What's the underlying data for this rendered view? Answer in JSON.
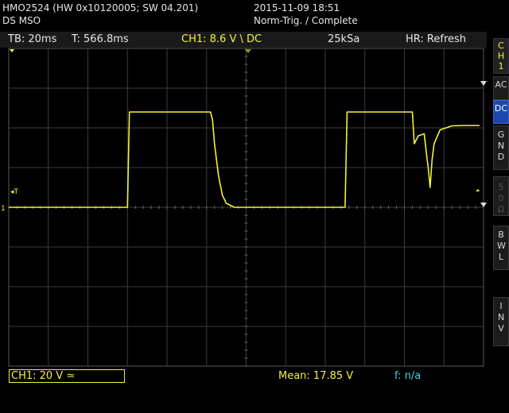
{
  "header": {
    "model": "HMO2524 (HW 0x10120005; SW 04.201)",
    "type": "DS MSO",
    "datetime": "2015-11-09 18:51",
    "trigger_status": "Norm-Trig. / Complete"
  },
  "infobar": {
    "timebase": "TB: 20ms",
    "trigger_time": "T: 566.8ms",
    "channel_trigger": "CH1: 8.6 V \\ DC",
    "sample_rate": "25kSa",
    "acquisition": "HR: Refresh"
  },
  "sidebar": {
    "channel_tab": [
      "C",
      "H",
      "1"
    ],
    "buttons": [
      {
        "label": "AC",
        "active": false
      },
      {
        "label": "DC",
        "active": true
      },
      {
        "label": "GND",
        "active": false
      },
      {
        "label": "50Ω",
        "active": false
      },
      {
        "label": "BWL",
        "active": false
      },
      {
        "label": "INV",
        "active": false
      }
    ]
  },
  "footer": {
    "channel_scale": "CH1: 20 V ≃",
    "mean": "Mean: 17.85 V",
    "frequency": "f: n/a"
  },
  "markers": {
    "trigger_label": "T",
    "channel_marker": "1"
  },
  "colors": {
    "trace": "#f2f23a",
    "grid": "#3c3c3c",
    "active_button": "#1c48b0",
    "frequency_text": "#3ad6e6"
  },
  "chart_data": {
    "type": "line",
    "title": "",
    "xlabel": "",
    "ylabel": "",
    "x_divisions": 12,
    "y_divisions": 8,
    "xlim": [
      0,
      12
    ],
    "ylim": [
      -4,
      4
    ],
    "series": [
      {
        "values_description_ignored": null,
        "points": [
          [
            0.0,
            0.0
          ],
          [
            3.0,
            0.0
          ],
          [
            3.05,
            2.4
          ],
          [
            5.1,
            2.4
          ],
          [
            5.15,
            2.2
          ],
          [
            5.2,
            1.6
          ],
          [
            5.3,
            0.8
          ],
          [
            5.4,
            0.3
          ],
          [
            5.5,
            0.1
          ],
          [
            5.7,
            0.0
          ],
          [
            8.5,
            0.0
          ],
          [
            8.55,
            2.4
          ],
          [
            10.2,
            2.4
          ],
          [
            10.25,
            1.6
          ],
          [
            10.35,
            1.8
          ],
          [
            10.5,
            1.85
          ],
          [
            10.55,
            1.4
          ],
          [
            10.6,
            1.0
          ],
          [
            10.65,
            0.5
          ],
          [
            10.7,
            1.2
          ],
          [
            10.75,
            1.6
          ],
          [
            10.9,
            1.95
          ],
          [
            11.2,
            2.05
          ],
          [
            11.5,
            2.06
          ],
          [
            11.9,
            2.06
          ]
        ]
      }
    ]
  }
}
